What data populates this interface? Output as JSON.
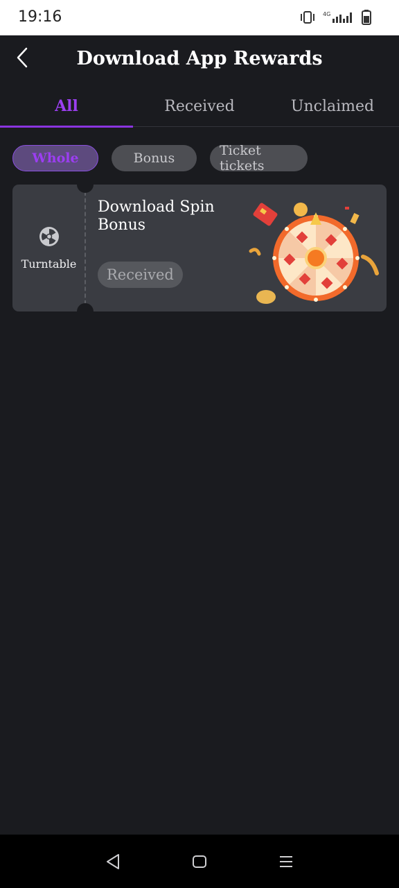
{
  "status_bar": {
    "time": "19:16",
    "network": "4G",
    "icons": [
      "vibrate-icon",
      "signal-icon",
      "signal-icon",
      "battery-icon"
    ]
  },
  "header": {
    "back_icon": "chevron-left-icon",
    "title": "Download App Rewards"
  },
  "tabs": [
    {
      "label": "All",
      "active": true
    },
    {
      "label": "Received",
      "active": false
    },
    {
      "label": "Unclaimed",
      "active": false
    }
  ],
  "filters": [
    {
      "label": "Whole",
      "selected": true
    },
    {
      "label": "Bonus",
      "selected": false
    },
    {
      "label": "Ticket tickets",
      "selected": false
    }
  ],
  "rewards": [
    {
      "type_icon": "turntable-icon",
      "type_label": "Turntable",
      "title": "Download Spin Bonus",
      "status": "Received",
      "image": "prize-wheel-illustration"
    }
  ],
  "nav_bar": {
    "icons": [
      "back-triangle-icon",
      "home-square-icon",
      "menu-icon"
    ]
  },
  "colors": {
    "background": "#1a1b1f",
    "accent": "#9b3ff0",
    "card": "#3a3c42",
    "chip": "#4d4e53"
  }
}
